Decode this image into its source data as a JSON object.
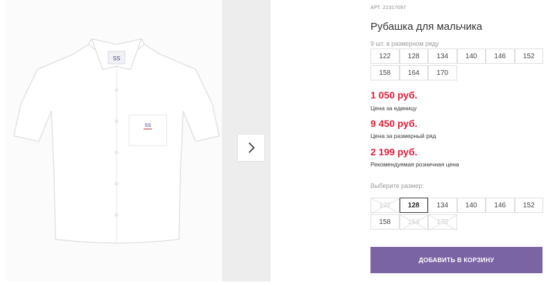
{
  "product": {
    "article": "АРТ. 22317097",
    "title": "Рубашка для мальчика"
  },
  "gallery": {
    "next_icon": "chevron-right-icon"
  },
  "size_range": {
    "note": "9 шт. в размерном ряду",
    "sizes": [
      "122",
      "128",
      "134",
      "140",
      "146",
      "152",
      "158",
      "164",
      "170"
    ]
  },
  "prices": {
    "unit_price": "1 050 руб.",
    "unit_label": "Цена за единицу",
    "range_price": "9 450 руб.",
    "range_label": "Цена за размерный ряд",
    "retail_price": "2 199 руб.",
    "retail_label": "Рекомендуемая розничная цена",
    "accent_color": "#e0203a"
  },
  "size_select": {
    "label": "Выберите размер:",
    "options": [
      {
        "label": "122",
        "available": false,
        "selected": false
      },
      {
        "label": "128",
        "available": true,
        "selected": true
      },
      {
        "label": "134",
        "available": true,
        "selected": false
      },
      {
        "label": "140",
        "available": true,
        "selected": false
      },
      {
        "label": "146",
        "available": true,
        "selected": false
      },
      {
        "label": "152",
        "available": true,
        "selected": false
      },
      {
        "label": "158",
        "available": true,
        "selected": false
      },
      {
        "label": "164",
        "available": false,
        "selected": false
      },
      {
        "label": "170",
        "available": false,
        "selected": false
      }
    ]
  },
  "cart": {
    "button_label": "ДОБАВИТЬ В КОРЗИНУ",
    "color": "#7b64a3"
  }
}
